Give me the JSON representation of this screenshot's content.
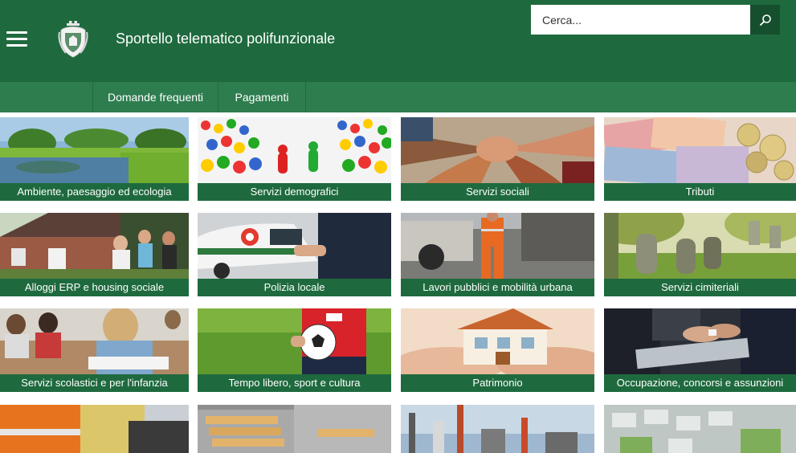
{
  "header": {
    "title": "Sportello telematico polifunzionale",
    "logo": "municipal-crest-icon",
    "menu_icon": "hamburger-menu-icon"
  },
  "search": {
    "placeholder": "Cerca...",
    "button_icon": "search-icon"
  },
  "nav": {
    "items": [
      {
        "label": "Domande frequenti"
      },
      {
        "label": "Pagamenti"
      }
    ]
  },
  "tiles": [
    {
      "label": "Ambiente, paesaggio ed ecologia"
    },
    {
      "label": "Servizi demografici"
    },
    {
      "label": "Servizi sociali"
    },
    {
      "label": "Tributi"
    },
    {
      "label": "Alloggi ERP e housing sociale"
    },
    {
      "label": "Polizia locale"
    },
    {
      "label": "Lavori pubblici e mobilità urbana"
    },
    {
      "label": "Servizi cimiteriali"
    },
    {
      "label": "Servizi scolastici e per l'infanzia"
    },
    {
      "label": "Tempo libero, sport e cultura"
    },
    {
      "label": "Patrimonio"
    },
    {
      "label": "Occupazione, concorsi e assunzioni"
    }
  ],
  "colors": {
    "header": "#1e6a3e",
    "nav": "#2e7d4f",
    "label_bar": "#1e6a3e",
    "search_button": "#164f2e"
  }
}
